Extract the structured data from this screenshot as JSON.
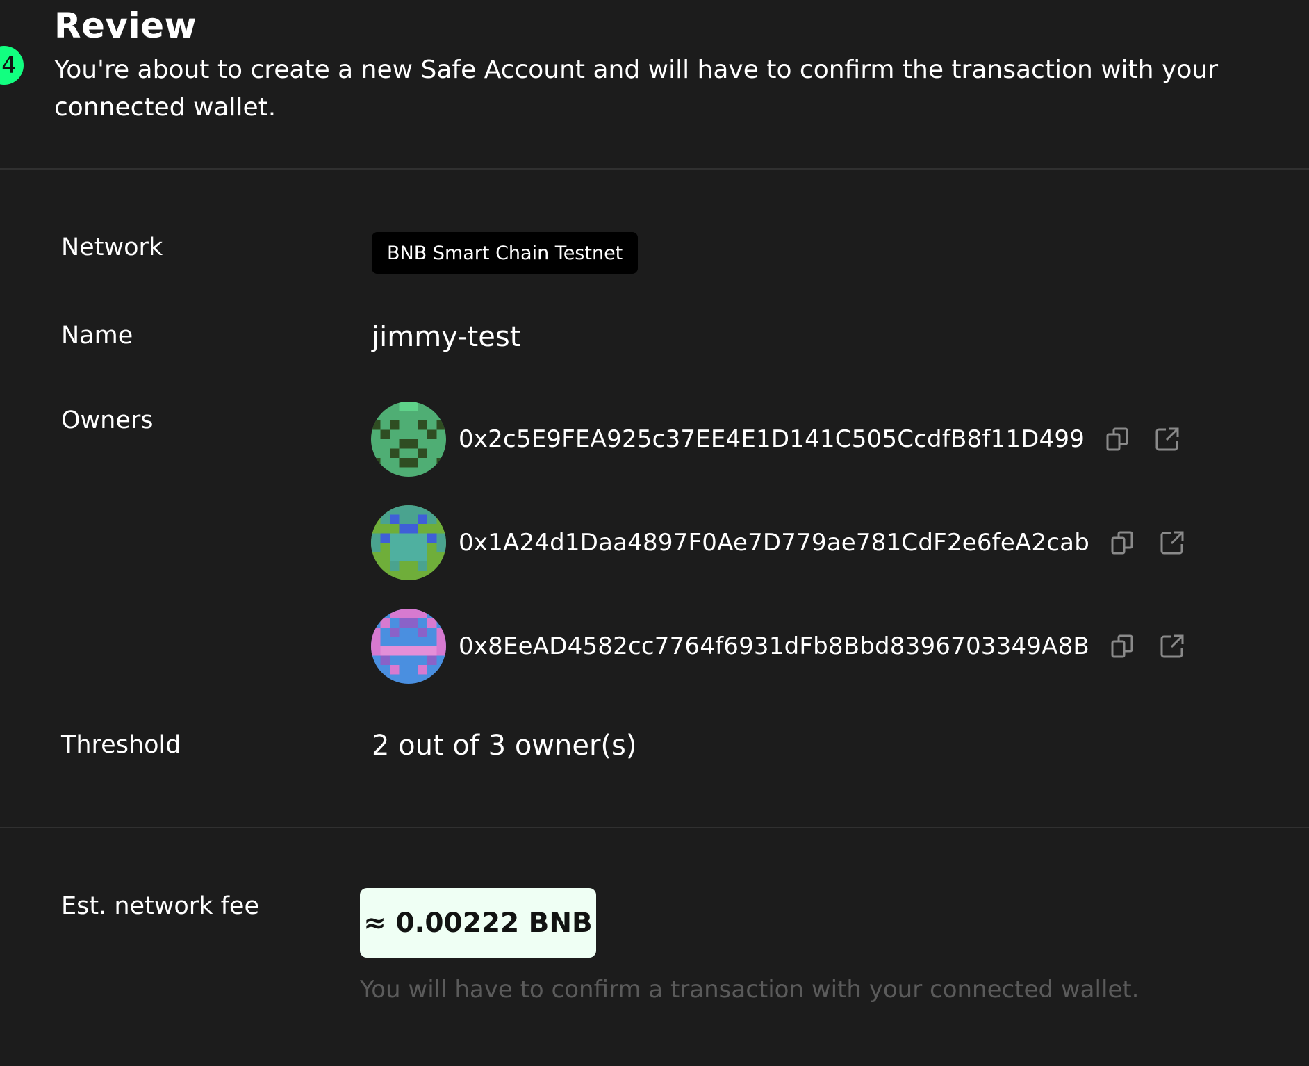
{
  "header": {
    "step_number": "4",
    "title": "Review",
    "subtitle": "You're about to create a new Safe Account and will have to confirm the transaction with your connected wallet."
  },
  "details": {
    "network_label": "Network",
    "network_value": "BNB Smart Chain Testnet",
    "name_label": "Name",
    "name_value": "jimmy-test",
    "owners_label": "Owners",
    "owners": [
      {
        "address": "0x2c5E9FEA925c37EE4E1D141C505CcdfB8f11D499",
        "avatar_icon": "identicon-green"
      },
      {
        "address": "0x1A24d1Daa4897F0Ae7D779ae781CdF2e6feA2cab",
        "avatar_icon": "identicon-green-blue"
      },
      {
        "address": "0x8EeAD4582cc7764f6931dFb8Bbd8396703349A8B",
        "avatar_icon": "identicon-blue-pink"
      }
    ],
    "threshold_label": "Threshold",
    "threshold_value": "2 out of 3 owner(s)"
  },
  "fee": {
    "label": "Est. network fee",
    "value": "≈ 0.00222 BNB",
    "note": "You will have to confirm a transaction with your connected wallet."
  },
  "icons": {
    "copy": "copy-icon",
    "external_link": "external-link-icon"
  },
  "colors": {
    "background": "#1c1c1c",
    "accent": "#12ff80",
    "chip_background": "#000000",
    "fee_background": "#effff4",
    "muted_text": "#5b5b5b"
  }
}
